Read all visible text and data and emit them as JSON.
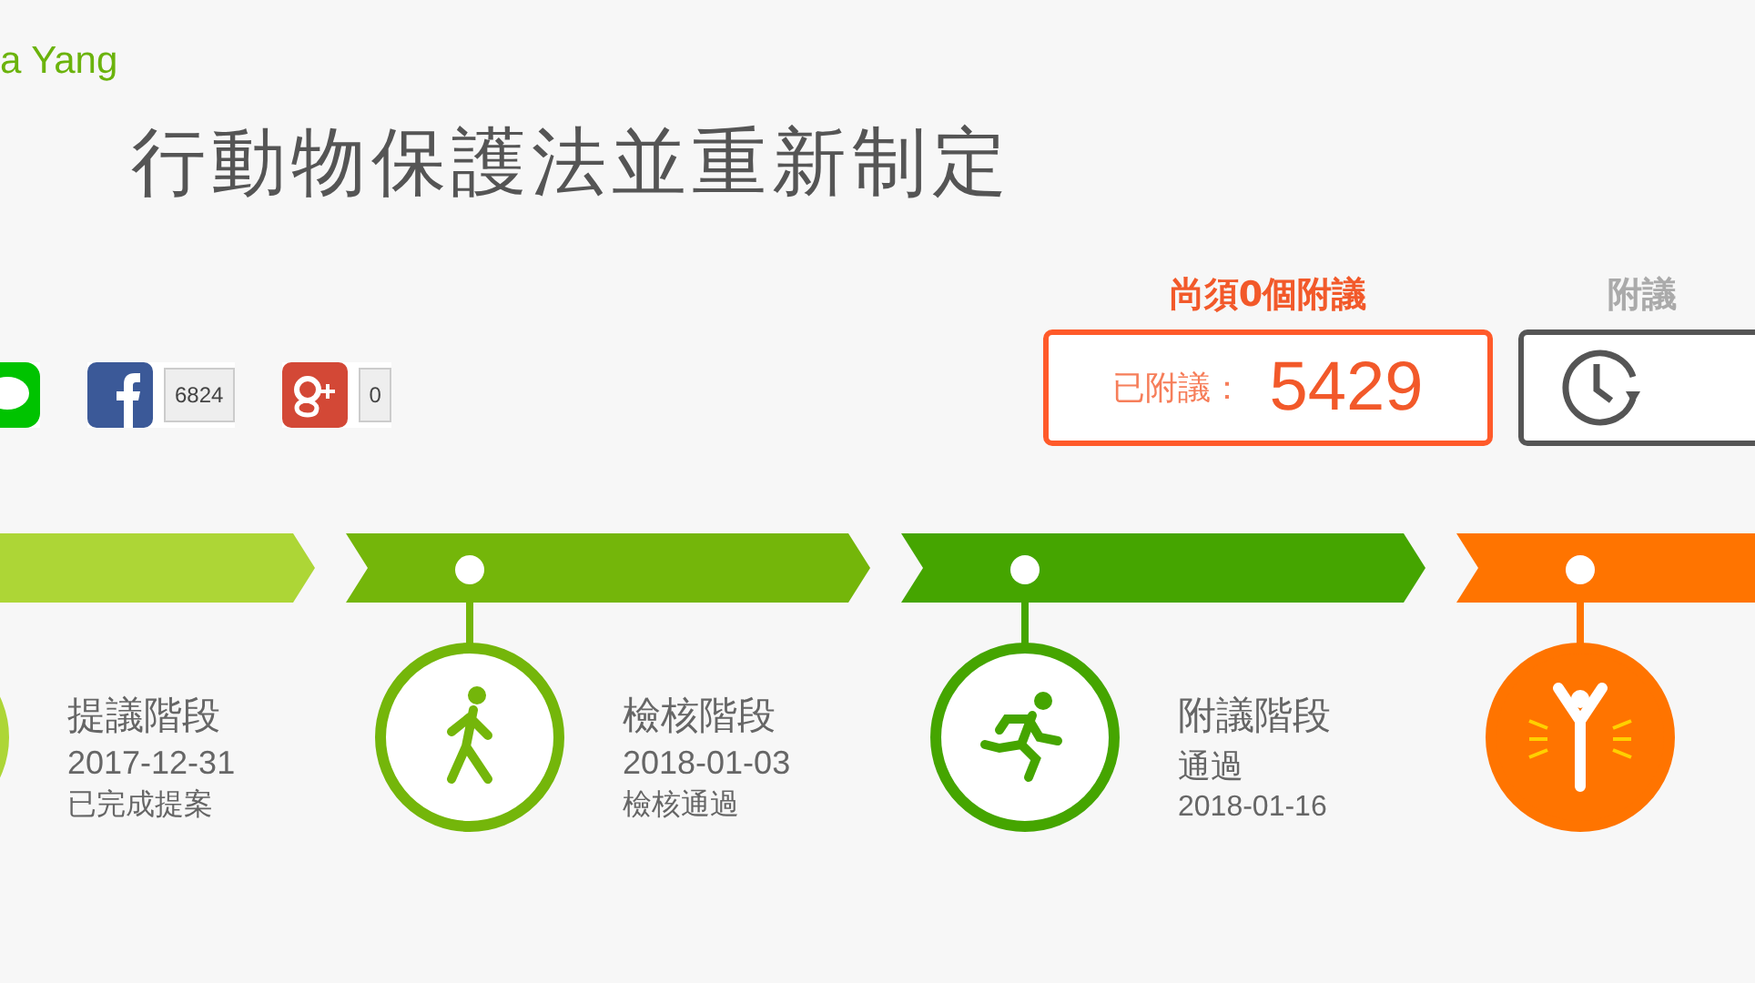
{
  "author": "a Yang",
  "title": "行動物保護法並重新制定",
  "shares": [
    {
      "kind": "line"
    },
    {
      "kind": "facebook",
      "count": "6824"
    },
    {
      "kind": "googleplus",
      "count": "0"
    }
  ],
  "counter": {
    "remaining": "尚須0個附議",
    "label": "已附議：",
    "value": "5429"
  },
  "period": {
    "label": "附議"
  },
  "stages": [
    {
      "kind": "proposal",
      "color": "#add636",
      "filled": false,
      "title": "提議階段",
      "lines": [
        "2017-12-31",
        "已完成提案"
      ]
    },
    {
      "kind": "review",
      "color": "#74b60a",
      "filled": false,
      "title": "檢核階段",
      "lines": [
        "2018-01-03",
        "檢核通過"
      ]
    },
    {
      "kind": "endorse",
      "color": "#45a500",
      "filled": false,
      "title": "附議階段",
      "lines": [
        "通過",
        "2018-01-16"
      ]
    },
    {
      "kind": "response",
      "color": "#ff7400",
      "filled": true
    }
  ]
}
